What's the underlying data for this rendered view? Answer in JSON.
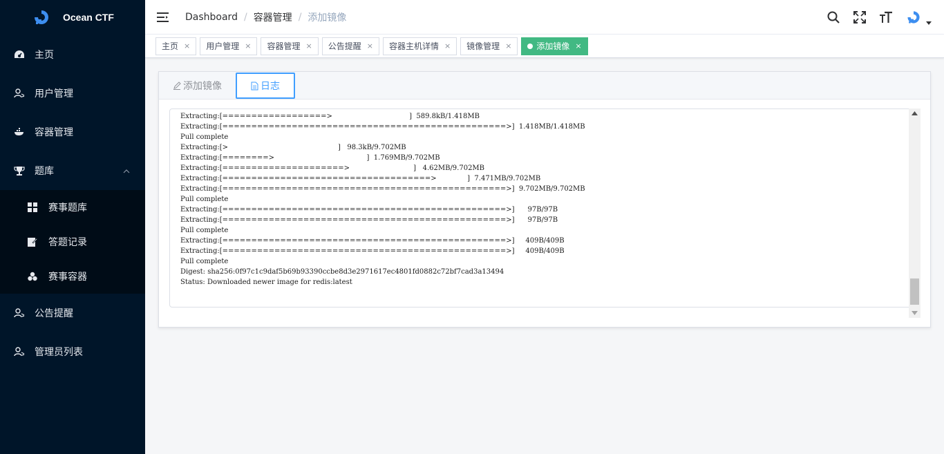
{
  "app": {
    "name": "Ocean CTF"
  },
  "sidebar": {
    "items": [
      {
        "label": "主页",
        "icon": "dashboard-icon"
      },
      {
        "label": "用户管理",
        "icon": "user-icon"
      },
      {
        "label": "容器管理",
        "icon": "docker-icon"
      },
      {
        "label": "题库",
        "icon": "trophy-icon",
        "expanded": true
      }
    ],
    "submenu": [
      {
        "label": "赛事题库",
        "icon": "grid-icon"
      },
      {
        "label": "答题记录",
        "icon": "document-edit-icon"
      },
      {
        "label": "赛事容器",
        "icon": "cubes-icon"
      }
    ],
    "after": [
      {
        "label": "公告提醒",
        "icon": "user-icon"
      },
      {
        "label": "管理员列表",
        "icon": "user-icon"
      }
    ]
  },
  "breadcrumb": [
    "Dashboard",
    "容器管理",
    "添加镜像"
  ],
  "breadcrumb_sep": "/",
  "tags": [
    {
      "label": "主页",
      "close": "×"
    },
    {
      "label": "用户管理",
      "close": "×"
    },
    {
      "label": "容器管理",
      "close": "×"
    },
    {
      "label": "公告提醒",
      "close": "×"
    },
    {
      "label": "容器主机详情",
      "close": "×"
    },
    {
      "label": "镜像管理",
      "close": "×"
    },
    {
      "label": "添加镜像",
      "close": "×",
      "active": true
    }
  ],
  "card": {
    "tabs": [
      {
        "label": "添加镜像",
        "icon": "edit-icon",
        "active": false
      },
      {
        "label": "日志",
        "icon": "document-icon",
        "active": true
      }
    ]
  },
  "log": [
    "Extracting:[==================>                                   ]  589.8kB/1.418MB",
    "Extracting:[=================================================>]  1.418MB/1.418MB",
    "Pull complete",
    "Extracting:[>                                                  ]   98.3kB/9.702MB",
    "Extracting:[========>                                          ]  1.769MB/9.702MB",
    "Extracting:[=====================>                             ]   4.62MB/9.702MB",
    "Extracting:[====================================>              ]  7.471MB/9.702MB",
    "Extracting:[=================================================>]  9.702MB/9.702MB",
    "Pull complete",
    "Extracting:[=================================================>]      97B/97B",
    "Extracting:[=================================================>]      97B/97B",
    "Pull complete",
    "Extracting:[=================================================>]     409B/409B",
    "Extracting:[=================================================>]     409B/409B",
    "Pull complete",
    "Digest: sha256:0f97c1c9daf5b69b93390ccbe8d3e2971617ec4801fd0882c72bf7cad3a13494",
    "Status: Downloaded newer image for redis:latest"
  ],
  "colors": {
    "sidebar_bg": "#001529",
    "submenu_bg": "#000c17",
    "accent": "#409eff",
    "active_tag": "#42b983"
  }
}
